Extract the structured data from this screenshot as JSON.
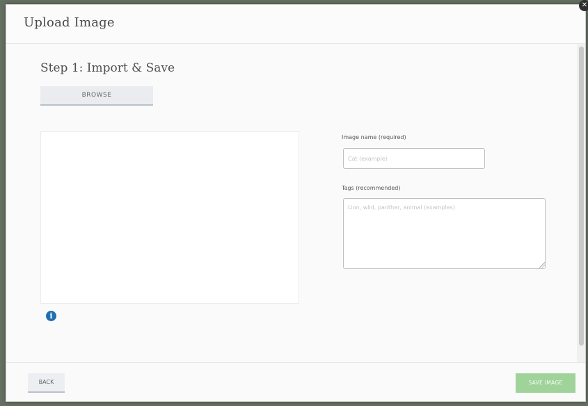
{
  "modal": {
    "title": "Upload Image",
    "close_icon": "close-icon"
  },
  "step": {
    "title": "Step 1: Import & Save",
    "browse_label": "BROWSE"
  },
  "preview": {
    "info_icon": "info-icon",
    "info_glyph": "i"
  },
  "form": {
    "name_label": "Image name (required)",
    "name_value": "",
    "name_placeholder": "Cat (example)",
    "tags_label": "Tags (recommended)",
    "tags_value": "",
    "tags_placeholder": "Lion, wild, panther, animal (examples)"
  },
  "footer": {
    "back_label": "BACK",
    "save_label": "SAVE IMAGE"
  },
  "colors": {
    "info_icon": "#1f6fb0",
    "save_button": "#9fd39a",
    "browse_button": "#eaecef"
  }
}
